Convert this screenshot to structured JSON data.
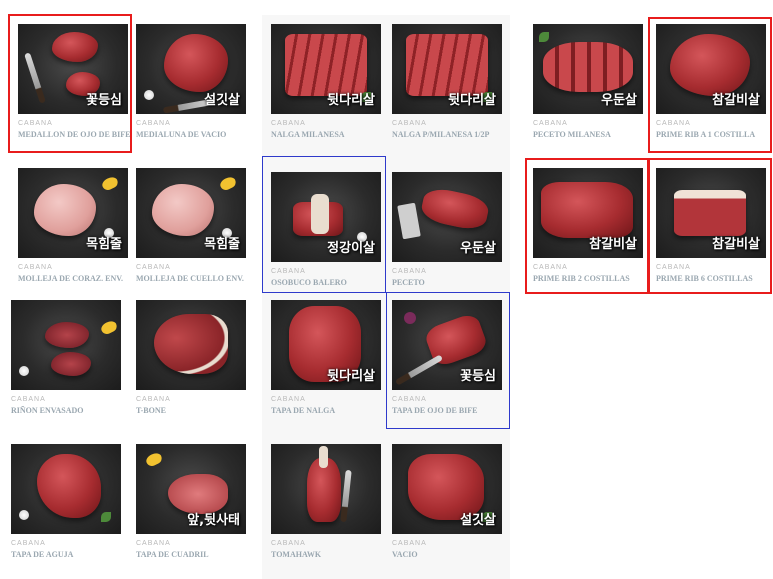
{
  "brand": "CABANA",
  "colors": {
    "red_box": "#e81c1c",
    "blue_box": "#2e3acb",
    "title_text": "#9aa7b0"
  },
  "products": [
    {
      "id": "medallon",
      "title": "MEDALLON DE OJO DE BIFE",
      "overlay": "꽃등심"
    },
    {
      "id": "medialuna",
      "title": "MEDIALUNA DE VACIO",
      "overlay": "설깃살"
    },
    {
      "id": "nalga-milanesa",
      "title": "NALGA MILANESA",
      "overlay": "뒷다리살"
    },
    {
      "id": "nalga-p-milanesa",
      "title": "NALGA P/MILANESA 1/2P",
      "overlay": "뒷다리살"
    },
    {
      "id": "peceto-milanesa",
      "title": "PECETO MILANESA",
      "overlay": "우둔살"
    },
    {
      "id": "prime-rib-1",
      "title": "PRIME RIB A 1 COSTILLA",
      "overlay": "참갈비살"
    },
    {
      "id": "molleja-coraz",
      "title": "MOLLEJA DE CORAZ. ENV.",
      "overlay": "목힘줄"
    },
    {
      "id": "molleja-cuello",
      "title": "MOLLEJA DE CUELLO ENV.",
      "overlay": "목힘줄"
    },
    {
      "id": "osobuco",
      "title": "OSOBUCO BALERO",
      "overlay": "정강이살"
    },
    {
      "id": "peceto",
      "title": "PECETO",
      "overlay": "우둔살"
    },
    {
      "id": "prime-rib-2",
      "title": "PRIME RIB 2 COSTILLAS",
      "overlay": "참갈비살"
    },
    {
      "id": "prime-rib-6",
      "title": "PRIME RIB 6 COSTILLAS",
      "overlay": "참갈비살"
    },
    {
      "id": "rinon",
      "title": "RIÑON ENVASADO",
      "overlay": ""
    },
    {
      "id": "tbone",
      "title": "T-BONE",
      "overlay": ""
    },
    {
      "id": "tapa-nalga",
      "title": "TAPA DE NALGA",
      "overlay": "뒷다리살"
    },
    {
      "id": "tapa-ojo",
      "title": "TAPA DE OJO DE BIFE",
      "overlay": "꽃등심"
    },
    {
      "id": "tapa-aguja",
      "title": "TAPA DE AGUJA",
      "overlay": ""
    },
    {
      "id": "tapa-cuadril",
      "title": "TAPA DE CUADRIL",
      "overlay": "앞,뒷사태"
    },
    {
      "id": "tomahawk",
      "title": "TOMAHAWK",
      "overlay": ""
    },
    {
      "id": "vacio",
      "title": "VACIO",
      "overlay": "설깃살"
    }
  ]
}
